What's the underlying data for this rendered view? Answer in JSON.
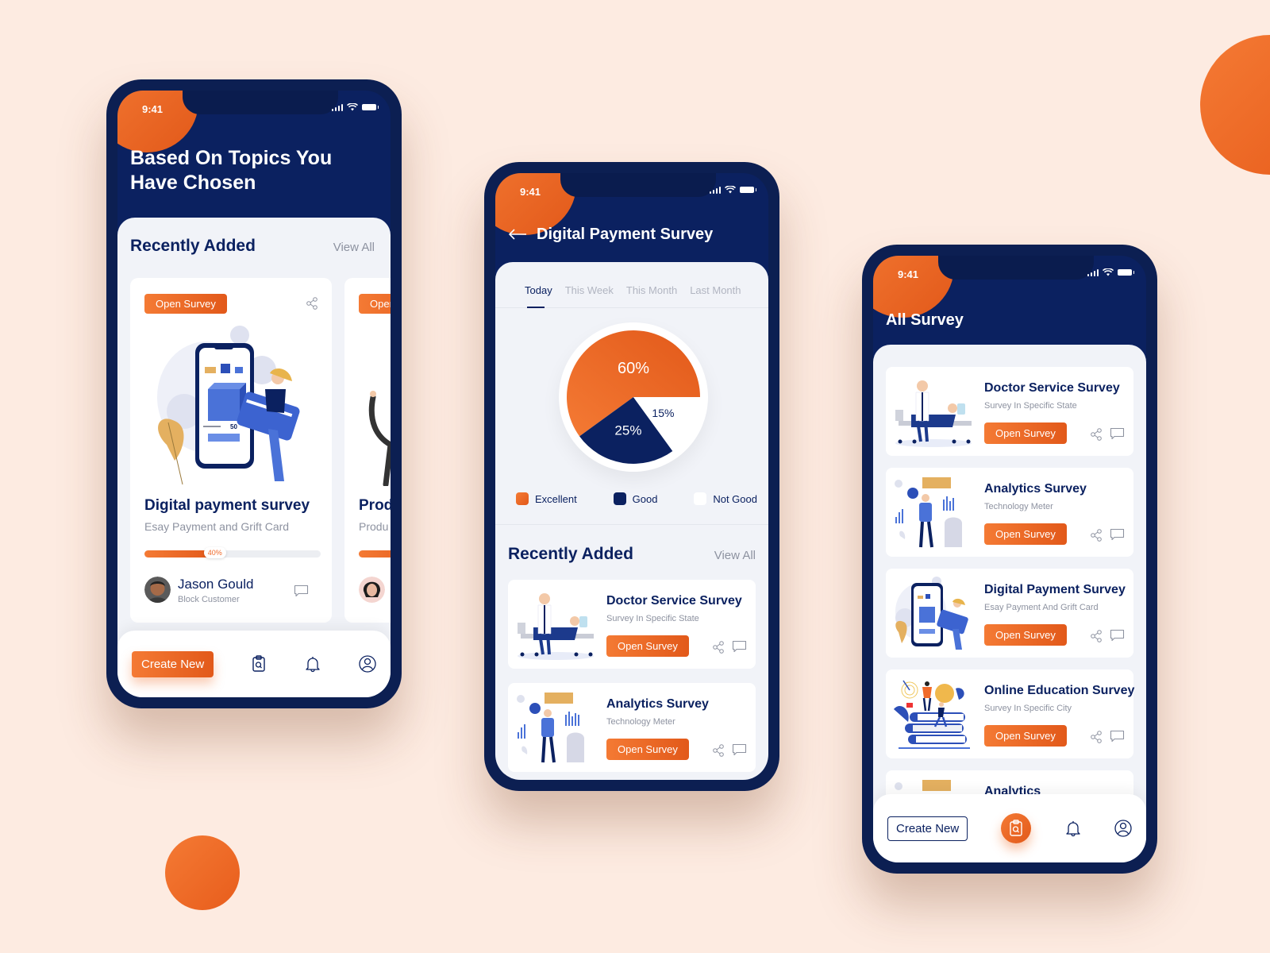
{
  "colors": {
    "accent": "#f06a2a",
    "navy": "#0b2160",
    "background": "#fdebe1",
    "panel": "#f1f3f8"
  },
  "status_bar": {
    "time": "9:41"
  },
  "screen1": {
    "title_line1": "Based On Topics You",
    "title_line2": "Have Chosen",
    "section_title": "Recently Added",
    "view_all": "View All",
    "cards": [
      {
        "button": "Open Survey",
        "title": "Digital payment survey",
        "subtitle": "Esay Payment and Grift Card",
        "progress_percent": 40,
        "progress_label": "40%",
        "user_name": "Jason Gould",
        "user_role": "Block Customer"
      },
      {
        "button": "Open Survey",
        "title": "Prod",
        "subtitle": "Produ",
        "progress_percent": 40
      }
    ],
    "nav": {
      "create_new": "Create New"
    }
  },
  "screen2": {
    "title": "Digital Payment Survey",
    "tabs": [
      "Today",
      "This Week",
      "This Month",
      "Last Month"
    ],
    "active_tab": "Today",
    "section_title": "Recently Added",
    "view_all": "View All",
    "items": [
      {
        "title": "Doctor Service Survey",
        "subtitle": "Survey In Specific State",
        "button": "Open Survey"
      },
      {
        "title": "Analytics Survey",
        "subtitle": "Technology  Meter",
        "button": "Open Survey"
      }
    ]
  },
  "chart_data": {
    "type": "pie",
    "title": "",
    "categories": [
      "Excellent",
      "Good",
      "Not Good"
    ],
    "values": [
      60,
      25,
      15
    ],
    "labels": [
      "60%",
      "25%",
      "15%"
    ],
    "colors": [
      "#f06a2a",
      "#0b2160",
      "#ffffff"
    ],
    "legend": "bottom"
  },
  "screen3": {
    "title": "All Survey",
    "items": [
      {
        "title": "Doctor Service Survey",
        "subtitle": "Survey In Specific State",
        "button": "Open Survey"
      },
      {
        "title": "Analytics Survey",
        "subtitle": "Technology  Meter",
        "button": "Open Survey"
      },
      {
        "title": "Digital Payment Survey",
        "subtitle": "Esay Payment And Grift Card",
        "button": "Open Survey"
      },
      {
        "title": "Online Education Survey",
        "subtitle": "Survey In Specific City",
        "button": "Open Survey"
      },
      {
        "title": "Analytics",
        "subtitle": "",
        "button": ""
      }
    ],
    "nav": {
      "create_new": "Create New"
    }
  }
}
